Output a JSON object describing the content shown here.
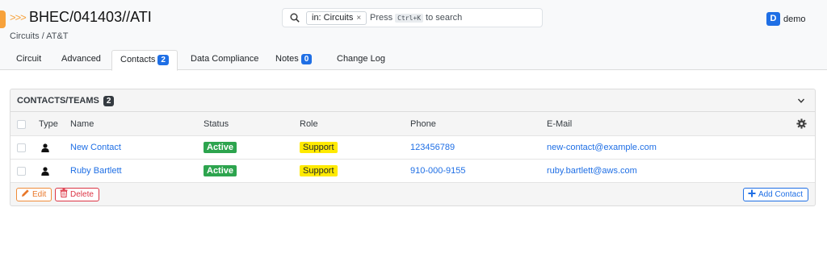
{
  "header": {
    "chevrons": ">>>",
    "title": "BHEC/041403//ATI",
    "breadcrumb": "Circuits / AT&T"
  },
  "search": {
    "chip_label": "in: Circuits",
    "chip_close": "×",
    "hint_before": "Press",
    "shortcut": "Ctrl+K",
    "hint_after": "to search"
  },
  "user": {
    "avatar_letter": "D",
    "name": "demo"
  },
  "tabs": [
    {
      "label": "Circuit"
    },
    {
      "label": "Advanced"
    },
    {
      "label": "Contacts",
      "count": "2",
      "active": true
    },
    {
      "label": "Data Compliance"
    },
    {
      "label": "Notes",
      "count": "0"
    },
    {
      "label": "Change Log"
    }
  ],
  "panel": {
    "title": "CONTACTS/TEAMS",
    "count": "2",
    "columns": [
      "Type",
      "Name",
      "Status",
      "Role",
      "Phone",
      "E-Mail"
    ],
    "rows": [
      {
        "name": "New Contact",
        "status": "Active",
        "role": "Support",
        "phone": "123456789",
        "email": "new-contact@example.com"
      },
      {
        "name": "Ruby Bartlett",
        "status": "Active",
        "role": "Support",
        "phone": "910-000-9155",
        "email": "ruby.bartlett@aws.com"
      }
    ],
    "buttons": {
      "edit": "Edit",
      "delete": "Delete",
      "add": "Add Contact"
    }
  },
  "colors": {
    "accent": "#1f6fe5",
    "orange": "#f7a23b",
    "active_green": "#2da44e",
    "support_yellow": "#ffea00",
    "danger": "#dc3545"
  }
}
